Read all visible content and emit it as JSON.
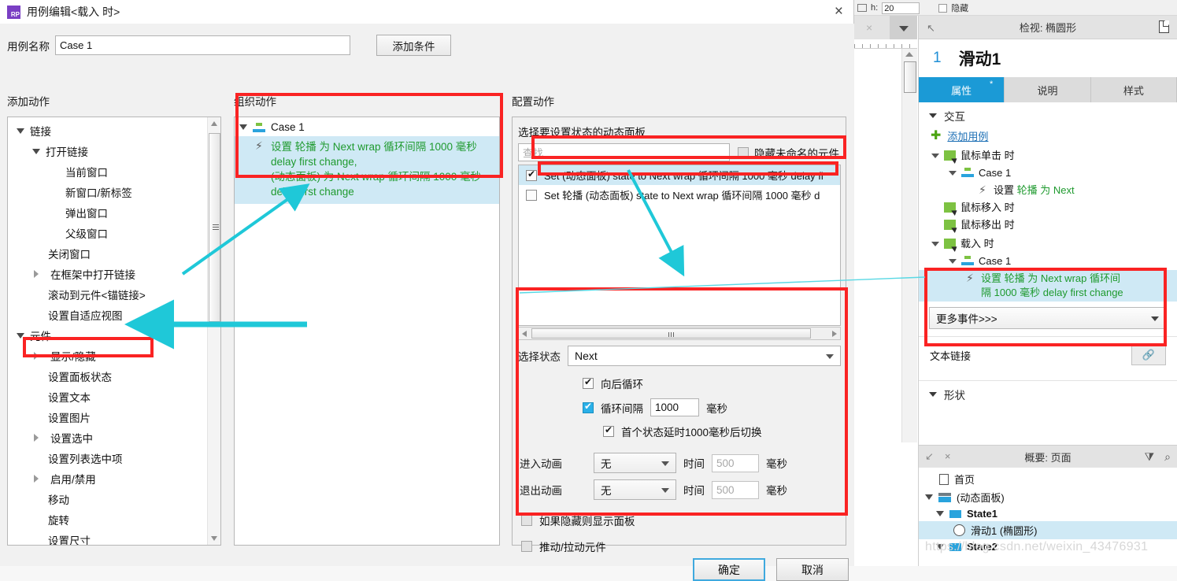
{
  "dialog": {
    "title": "用例编辑<载入 时>",
    "logo_text": "RP",
    "close_icon": "×",
    "case_name_label": "用例名称",
    "case_name_value": "Case 1",
    "add_condition_button": "添加条件",
    "columns": {
      "add_action": "添加动作",
      "organize_action": "组织动作",
      "configure_action": "配置动作"
    },
    "ok_button": "确定",
    "cancel_button": "取消"
  },
  "action_tree": [
    {
      "label": "链接",
      "indent": 0,
      "toggle": "open"
    },
    {
      "label": "打开链接",
      "indent": 1,
      "toggle": "open"
    },
    {
      "label": "当前窗口",
      "indent": 3,
      "toggle": "none"
    },
    {
      "label": "新窗口/新标签",
      "indent": 3,
      "toggle": "none"
    },
    {
      "label": "弹出窗口",
      "indent": 3,
      "toggle": "none"
    },
    {
      "label": "父级窗口",
      "indent": 3,
      "toggle": "none"
    },
    {
      "label": "关闭窗口",
      "indent": 2,
      "toggle": "none"
    },
    {
      "label": "在框架中打开链接",
      "indent": 1,
      "toggle": "closed"
    },
    {
      "label": "滚动到元件<锚链接>",
      "indent": 2,
      "toggle": "none"
    },
    {
      "label": "设置自适应视图",
      "indent": 2,
      "toggle": "none"
    },
    {
      "label": "元件",
      "indent": 0,
      "toggle": "open"
    },
    {
      "label": "显示/隐藏",
      "indent": 1,
      "toggle": "closed"
    },
    {
      "label": "设置面板状态",
      "indent": 2,
      "toggle": "none"
    },
    {
      "label": "设置文本",
      "indent": 2,
      "toggle": "none"
    },
    {
      "label": "设置图片",
      "indent": 2,
      "toggle": "none"
    },
    {
      "label": "设置选中",
      "indent": 1,
      "toggle": "closed"
    },
    {
      "label": "设置列表选中项",
      "indent": 2,
      "toggle": "none"
    },
    {
      "label": "启用/禁用",
      "indent": 1,
      "toggle": "closed"
    },
    {
      "label": "移动",
      "indent": 2,
      "toggle": "none"
    },
    {
      "label": "旋转",
      "indent": 2,
      "toggle": "none"
    },
    {
      "label": "设置尺寸",
      "indent": 2,
      "toggle": "none"
    }
  ],
  "organize": {
    "case_label": "Case 1",
    "action_lines": [
      "设置 轮播 为 Next wrap 循环间隔 1000 毫秒",
      "delay first change,",
      "(动态面板) 为 Next wrap 循环间隔 1000 毫秒",
      "delay first change"
    ]
  },
  "configure": {
    "select_panel_label": "选择要设置状态的动态面板",
    "find_placeholder": "查找",
    "hide_unnamed_label": "隐藏未命名的元件",
    "hide_unnamed_checked": false,
    "widget_rows": [
      {
        "label": "Set (动态面板) state to Next wrap 循环间隔 1000 毫秒 delay fi",
        "checked": true,
        "selected": true
      },
      {
        "label": "Set 轮播 (动态面板) state to Next wrap 循环间隔 1000 毫秒 d",
        "checked": false,
        "selected": false
      }
    ],
    "select_state_label": "选择状态",
    "select_state_value": "Next",
    "loop_back_label": "向后循环",
    "loop_back_checked": true,
    "loop_interval_label": "循环间隔",
    "loop_interval_value": "1000",
    "loop_interval_unit": "毫秒",
    "loop_interval_checked": true,
    "first_delay_label": "首个状态延时1000毫秒后切换",
    "first_delay_checked": true,
    "enter_anim_label": "进入动画",
    "enter_anim_value": "无",
    "enter_time_label": "时间",
    "enter_time_value": "500",
    "enter_time_unit": "毫秒",
    "exit_anim_label": "退出动画",
    "exit_anim_value": "无",
    "exit_time_label": "时间",
    "exit_time_value": "500",
    "exit_time_unit": "毫秒",
    "show_if_hidden_label": "如果隐藏则显示面板",
    "show_if_hidden_checked": false,
    "push_pull_label": "推动/拉动元件",
    "push_pull_checked": false
  },
  "app": {
    "topstrip": {
      "h_label": "h:",
      "h_value": "20",
      "hidden_label": "隐藏"
    },
    "inspector": {
      "header": "检视: 椭圆形",
      "item_number": "1",
      "item_name": "滑动1",
      "tabs": [
        {
          "label": "属性",
          "active": true,
          "star": "*"
        },
        {
          "label": "说明",
          "active": false,
          "star": ""
        },
        {
          "label": "样式",
          "active": false,
          "star": ""
        }
      ],
      "interaction_section": "交互",
      "add_case_link": "添加用例",
      "events": [
        {
          "type": "event",
          "label": "鼠标单击 时",
          "indent": 0,
          "toggle": "open"
        },
        {
          "type": "case",
          "label": "Case 1",
          "indent": 1,
          "toggle": "open"
        },
        {
          "type": "action",
          "label_parts": [
            {
              "t": "设置 ",
              "c": "dark"
            },
            {
              "t": "轮播 ",
              "c": "green"
            },
            {
              "t": "为 Next",
              "c": "green"
            }
          ],
          "indent": 2,
          "toggle": "none"
        },
        {
          "type": "event",
          "label": "鼠标移入 时",
          "indent": 0,
          "toggle": "none"
        },
        {
          "type": "event",
          "label": "鼠标移出 时",
          "indent": 0,
          "toggle": "none"
        },
        {
          "type": "event",
          "label": "载入 时",
          "indent": 0,
          "toggle": "open"
        },
        {
          "type": "case",
          "label": "Case 1",
          "indent": 1,
          "toggle": "open"
        },
        {
          "type": "action",
          "highlighted": true,
          "lines": [
            "设置 轮播 为 Next wrap 循环间",
            "隔 1000 毫秒 delay first change"
          ],
          "indent": 2,
          "toggle": "none"
        }
      ],
      "more_events": "更多事件>>>",
      "text_link_label": "文本链接",
      "shape_section": "形状"
    },
    "outline": {
      "header": "概要: 页面",
      "rows": [
        {
          "label": "首页",
          "indent": 0,
          "icon": "page",
          "toggle": "none",
          "selected": false
        },
        {
          "label": "(动态面板)",
          "indent": 1,
          "icon": "dynamic-panel",
          "toggle": "open",
          "selected": false
        },
        {
          "label": "State1",
          "indent": 2,
          "icon": "state",
          "toggle": "open",
          "selected": false,
          "bold": true
        },
        {
          "label": "滑动1 (椭圆形)",
          "indent": 3,
          "icon": "ellipse",
          "toggle": "none",
          "selected": true
        },
        {
          "label": "State2",
          "indent": 2,
          "icon": "state",
          "toggle": "open",
          "selected": false,
          "bold": true
        }
      ],
      "watermark": "https://blog.csdn.net/weixin_43476931"
    }
  },
  "colors": {
    "accent_blue": "#1b9ad6",
    "highlight_red": "#fa2323",
    "arrow_cyan": "#1fc8d8",
    "selection_blue": "#cfe9f5",
    "action_green": "#1f9a2f"
  }
}
